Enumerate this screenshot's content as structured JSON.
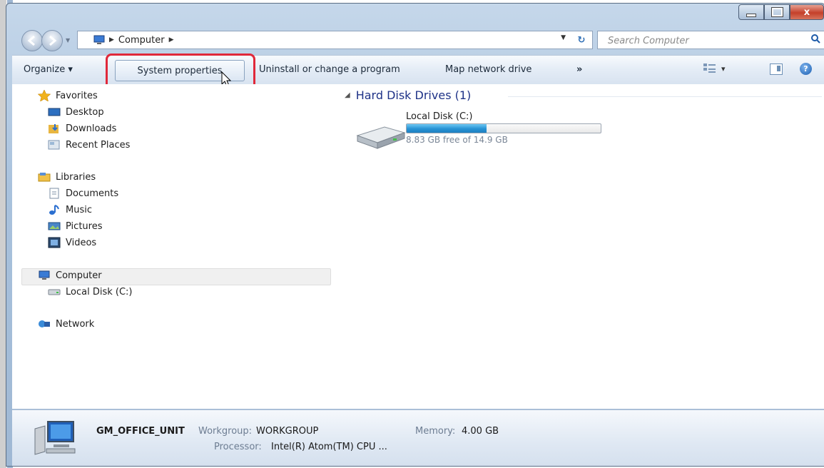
{
  "window": {
    "caption_buttons": [
      "minimize-icon",
      "maximize-icon",
      "close-icon"
    ],
    "close_glyph": "x"
  },
  "address_bar": {
    "crumbs": [
      "Computer"
    ],
    "search_placeholder": "Search Computer"
  },
  "toolbar": {
    "organize": "Organize ▾",
    "system_properties": "System properties",
    "uninstall": "Uninstall or change a program",
    "map_drive": "Map network drive",
    "overflow": "»",
    "views_arrow": "▾",
    "help": "?"
  },
  "nav": {
    "favorites": {
      "label": "Favorites",
      "icon": "star-icon"
    },
    "favorites_items": [
      {
        "label": "Desktop",
        "icon": "desktop-icon"
      },
      {
        "label": "Downloads",
        "icon": "downloads-icon"
      },
      {
        "label": "Recent Places",
        "icon": "recent-places-icon"
      }
    ],
    "libraries": {
      "label": "Libraries",
      "icon": "libraries-icon"
    },
    "libraries_items": [
      {
        "label": "Documents",
        "icon": "documents-icon"
      },
      {
        "label": "Music",
        "icon": "music-icon"
      },
      {
        "label": "Pictures",
        "icon": "pictures-icon"
      },
      {
        "label": "Videos",
        "icon": "videos-icon"
      }
    ],
    "computer": {
      "label": "Computer",
      "icon": "computer-icon"
    },
    "computer_items": [
      {
        "label": "Local Disk (C:)",
        "icon": "drive-icon"
      }
    ],
    "network": {
      "label": "Network",
      "icon": "network-icon"
    }
  },
  "main": {
    "group_header": "Hard Disk Drives (1)",
    "drive": {
      "name": "Local Disk (C:)",
      "free_text": "8.83 GB free of 14.9 GB",
      "used_fraction": 0.41
    }
  },
  "details": {
    "computer_name": "GM_OFFICE_UNIT",
    "workgroup_label": "Workgroup:",
    "workgroup_value": "WORKGROUP",
    "memory_label": "Memory:",
    "memory_value": "4.00 GB",
    "processor_label": "Processor:",
    "processor_value": "Intel(R) Atom(TM) CPU ..."
  },
  "colors": {
    "highlight_box": "#e0283a",
    "disk_fill": "#2692d4",
    "group_header": "#1e3287"
  }
}
